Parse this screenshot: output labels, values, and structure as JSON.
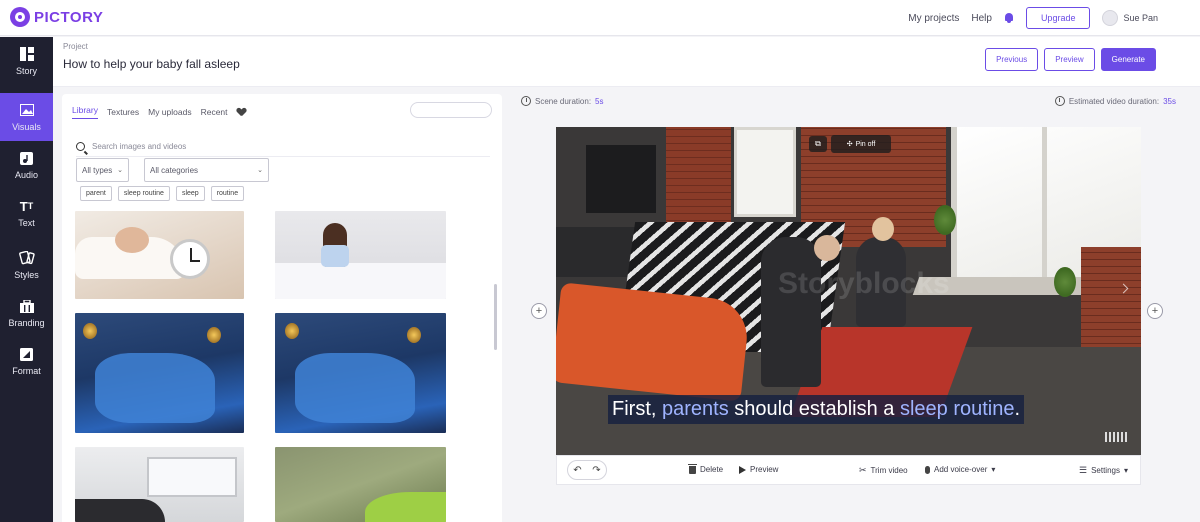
{
  "app": {
    "logo_text": "PICTORY",
    "brand_color": "#6b4ce6"
  },
  "topbar": {
    "my_projects": "My projects",
    "help": "Help",
    "upgrade": "Upgrade",
    "user_name": "Sue Pan"
  },
  "sidebar": {
    "items": [
      {
        "label": "Story",
        "icon": "layout-icon"
      },
      {
        "label": "Visuals",
        "icon": "image-icon",
        "active": true
      },
      {
        "label": "Audio",
        "icon": "music-icon"
      },
      {
        "label": "Text",
        "icon": "text-icon"
      },
      {
        "label": "Styles",
        "icon": "styles-icon"
      },
      {
        "label": "Branding",
        "icon": "briefcase-icon"
      },
      {
        "label": "Format",
        "icon": "format-icon"
      }
    ]
  },
  "project": {
    "label": "Project",
    "title": "How to help your baby fall asleep",
    "previous": "Previous",
    "preview": "Preview",
    "generate": "Generate"
  },
  "library": {
    "tabs": [
      "Library",
      "Textures",
      "My uploads",
      "Recent"
    ],
    "search_placeholder": "Search images and videos",
    "type_select": "All types",
    "category_select": "All categories",
    "tags": [
      "parent",
      "sleep routine",
      "sleep",
      "routine"
    ]
  },
  "scene": {
    "duration_label": "Scene duration:",
    "duration_value": "5s",
    "estimated_label": "Estimated video duration:",
    "estimated_value": "35s"
  },
  "video": {
    "watermark": "Storyblocks",
    "pin_label": "Pin off",
    "caption_parts": [
      "First, ",
      "parents",
      " should establish a ",
      "sleep routine",
      "."
    ]
  },
  "controls": {
    "delete": "Delete",
    "preview": "Preview",
    "trim": "Trim video",
    "voiceover": "Add voice-over",
    "settings": "Settings"
  }
}
